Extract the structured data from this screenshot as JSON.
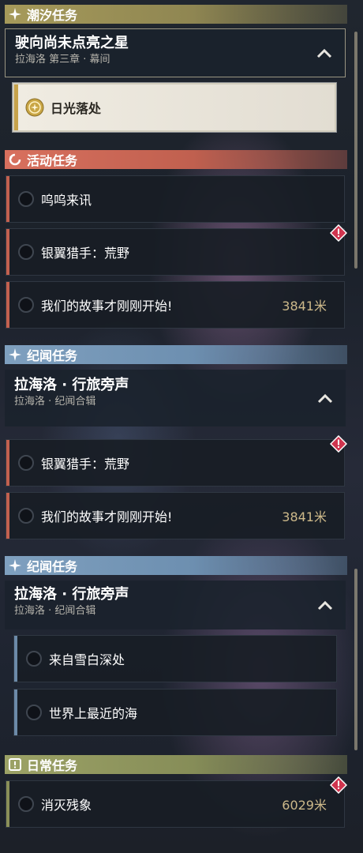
{
  "sections": {
    "tide": {
      "label": "潮汐任务",
      "icon": "sparkle-icon"
    },
    "event": {
      "label": "活动任务",
      "icon": "refresh-icon"
    },
    "chronicle": {
      "label": "纪闻任务",
      "icon": "sparkle-icon"
    },
    "daily": {
      "label": "日常任务",
      "icon": "exclamation-box-icon"
    }
  },
  "tide_chapter": {
    "title": "驶向尚未点亮之星",
    "subtitle": "拉海洛 第三章 · 幕间",
    "selected_quest": "日光落处"
  },
  "event_quests_top": [
    {
      "label": "呜呜来讯",
      "distance": "",
      "alert": false
    },
    {
      "label": "银翼猎手：荒野",
      "distance": "",
      "alert": true
    },
    {
      "label": "我们的故事才刚刚开始!",
      "distance": "3841米",
      "alert": false
    }
  ],
  "chronicle_chapter": {
    "title": "拉海洛 · 行旅旁声",
    "subtitle": "拉海洛 · 纪闻合辑"
  },
  "event_quests_bottom": [
    {
      "label": "银翼猎手：荒野",
      "distance": "",
      "alert": true
    },
    {
      "label": "我们的故事才刚刚开始!",
      "distance": "3841米",
      "alert": false
    }
  ],
  "chronicle_quests": [
    {
      "label": "来自雪白深处"
    },
    {
      "label": "世界上最近的海"
    }
  ],
  "daily_quests": [
    {
      "label": "消灭残象",
      "distance": "6029米",
      "alert": true
    }
  ],
  "colors": {
    "tide": "#a69a5a",
    "event": "#d8705e",
    "chronicle": "#7fa0bf",
    "daily": "#9ca266",
    "distance": "#cdb98a",
    "alert": "#d0354f"
  }
}
